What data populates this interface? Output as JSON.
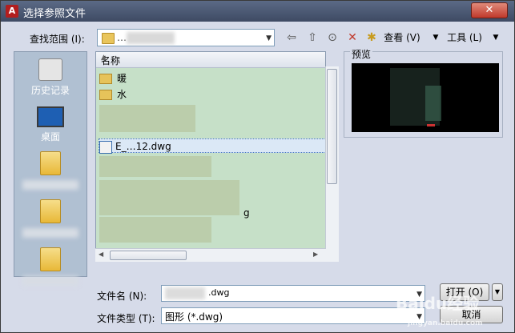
{
  "window": {
    "title": "选择参照文件",
    "close_glyph": "✕",
    "app_icon_glyph": "A"
  },
  "lookin": {
    "label": "查找范围 (I):",
    "value": "…"
  },
  "toolbar": {
    "back_glyph": "⇦",
    "up_glyph": "⇧",
    "search_glyph": "⊙",
    "delete_glyph": "✕",
    "newfolder_glyph": "✱",
    "views_label": "查看 (V)",
    "tools_label": "工具 (L)"
  },
  "places": {
    "history_label": "历史记录",
    "desktop_label": "桌面"
  },
  "list": {
    "column_name": "名称",
    "items": [
      "暖",
      "水"
    ],
    "selected_file": "E_…12.dwg",
    "partial_suffix": "g"
  },
  "preview": {
    "label": "预览"
  },
  "filename": {
    "label": "文件名 (N):",
    "value": ".dwg"
  },
  "filetype": {
    "label": "文件类型 (T):",
    "value": "图形 (*.dwg)"
  },
  "buttons": {
    "open_label": "打开 (O)",
    "cancel_label": "取消"
  },
  "watermark": {
    "text": "Baidu经验",
    "sub": "jingyan.baidu.com"
  },
  "colors": {
    "list_bg": "#c6e0c8",
    "places_bg": "#b0c0d2",
    "title_bg": "#4a5672"
  }
}
